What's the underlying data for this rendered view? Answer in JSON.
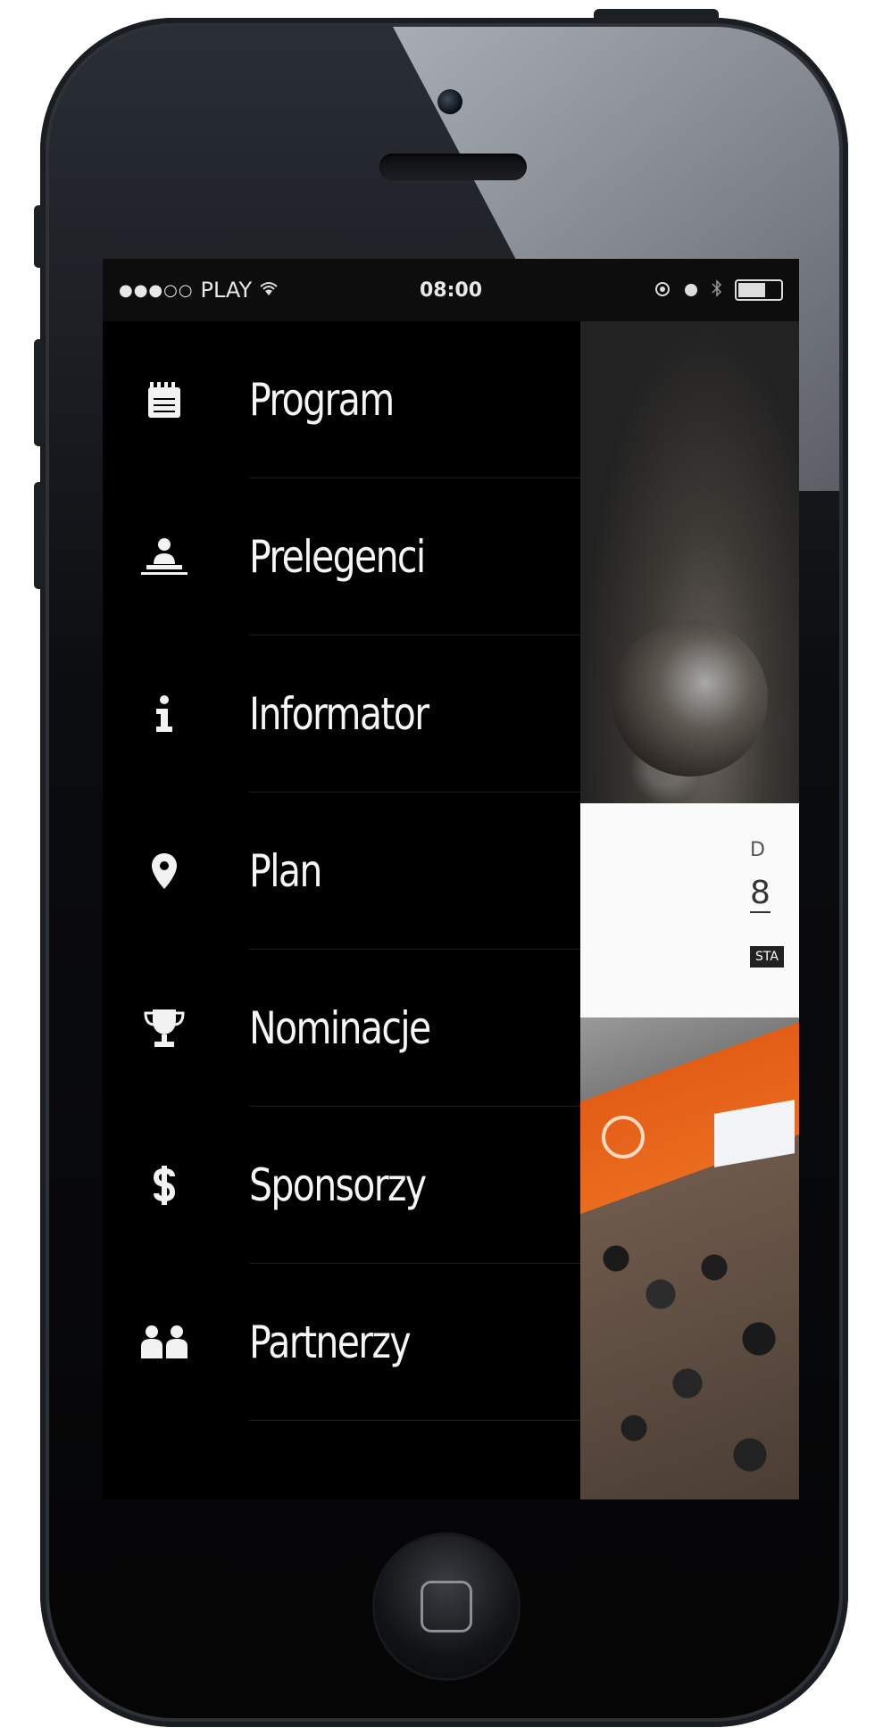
{
  "status_bar": {
    "signal": "●●●○○",
    "carrier": "PLAY",
    "time": "08:00"
  },
  "menu": [
    {
      "label": "Program",
      "icon": "notepad-icon"
    },
    {
      "label": "Prelegenci",
      "icon": "speaker-podium-icon"
    },
    {
      "label": "Informator",
      "icon": "info-icon"
    },
    {
      "label": "Plan",
      "icon": "map-pin-icon"
    },
    {
      "label": "Nominacje",
      "icon": "trophy-icon"
    },
    {
      "label": "Sponsorzy",
      "icon": "dollar-icon"
    },
    {
      "label": "Partnerzy",
      "icon": "partners-icon"
    }
  ],
  "content_card": {
    "line1": "D",
    "line2": "8",
    "tag": "STA"
  }
}
